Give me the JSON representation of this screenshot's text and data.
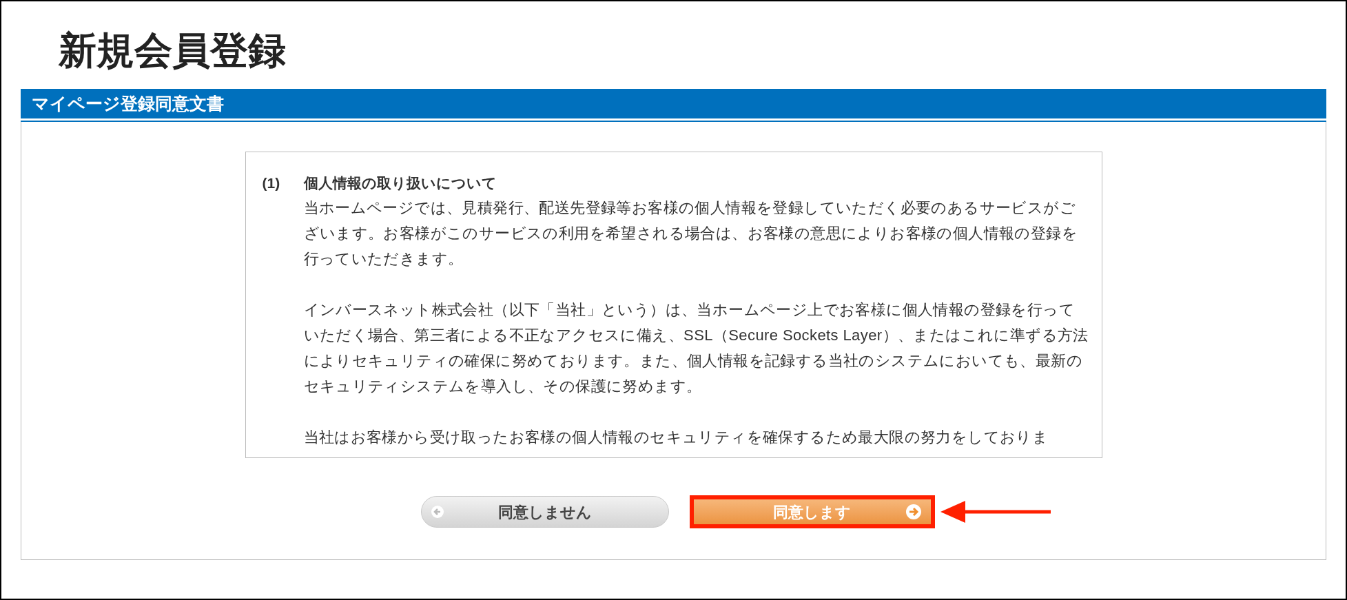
{
  "page_title": "新規会員登録",
  "section_header": "マイページ登録同意文書",
  "agreement": {
    "heading_number": "(1)",
    "heading": "個人情報の取り扱いについて",
    "paragraphs": [
      "当ホームページでは、見積発行、配送先登録等お客様の個人情報を登録していただく必要のあるサービスがございます。お客様がこのサービスの利用を希望される場合は、お客様の意思によりお客様の個人情報の登録を行っていただきます。",
      "インバースネット株式会社（以下「当社」という）は、当ホームページ上でお客様に個人情報の登録を行っていただく場合、第三者による不正なアクセスに備え、SSL（Secure Sockets Layer）、またはこれに準ずる方法によりセキュリティの確保に努めております。また、個人情報を記録する当社のシステムにおいても、最新のセキュリティシステムを導入し、その保護に努めます。",
      "当社はお客様から受け取ったお客様の個人情報のセキュリティを確保するため最大限の努力をしておりま"
    ]
  },
  "buttons": [
    {
      "kind": "decline",
      "label": "同意しません",
      "highlighted": false
    },
    {
      "kind": "agree",
      "label": "同意します",
      "highlighted": true
    }
  ]
}
